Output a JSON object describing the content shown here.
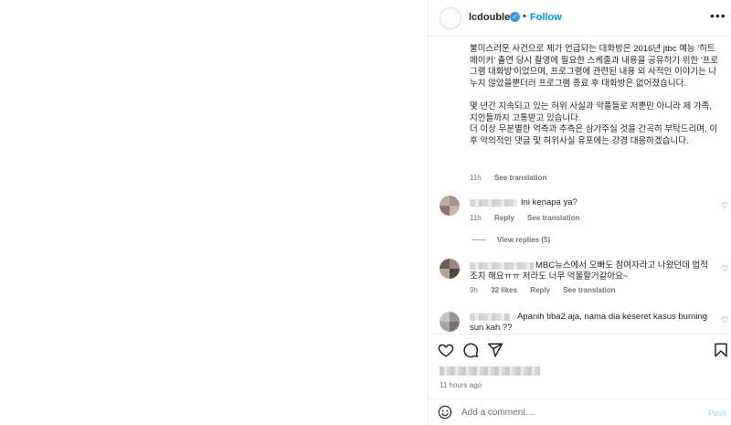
{
  "post": {
    "username": "lcdoubleu",
    "verified_glyph": "✓",
    "dot": "•",
    "follow_label": "Follow",
    "more_glyph": "•••",
    "caption": "불미스러운 사건으로 제가 언급되는 대화방은 2016년 jtbc 예능 '히트메이커' 출연 당시 촬영에 필요한 스케줄과 내용을 공유하기 위한 '프로그램 대화방'이었으며, 프로그램에 관련된 내용 외 사적인 이야기는 나누지 않았을뿐더러 프로그램 종료 후 대화방은 없어졌습니다.\n\n몇 년간 지속되고 있는 허위 사실과 악플들로 저뿐만 아니라 제 가족, 지인들까지 고통받고 있습니다.\n더 이상 무분별한 억측과 추측은 삼가주실 것을 간곡히 부탁드리며, 이후 악의적인 댓글 및 허위사실 유포에는 강경 대응하겠습니다.",
    "caption_time": "11h",
    "see_translation": "See translation",
    "timestamp": "11 hours ago"
  },
  "comments": [
    {
      "text": "Ini kenapa ya?",
      "time": "11h",
      "reply": "Reply",
      "translation": "See translation",
      "view_replies": "View replies (5)"
    },
    {
      "text": "MBC뉴스에서 오빠도 참여자라고 나왔던데 법적 조치 해요ㅠㅠ 저라도 너무 억울할거같아요~",
      "time": "9h",
      "likes": "32 likes",
      "reply": "Reply",
      "translation": "See translation"
    },
    {
      "text": "Apanih tiba2 aja, nama dia keseret kasus burning sun kah ??"
    }
  ],
  "composer": {
    "placeholder": "Add a comment…",
    "post_label": "Post"
  },
  "icons": {
    "heart": "heart-icon",
    "comment": "comment-icon",
    "share": "share-icon",
    "save": "bookmark-icon",
    "emoji": "emoji-icon"
  },
  "colors": {
    "accent": "#0095f6",
    "text": "#262626",
    "secondary": "#737373",
    "border": "#efefef"
  }
}
